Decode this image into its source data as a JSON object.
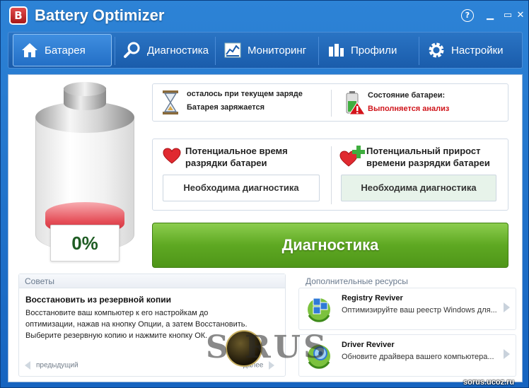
{
  "window": {
    "title": "Battery Optimizer",
    "logo_letter": "B",
    "help_label": "?",
    "minimize_label": "▁",
    "maximize_label": "▭",
    "close_label": "✕"
  },
  "nav": {
    "tabs": [
      {
        "label": "Батарея",
        "icon": "home-icon",
        "active": true
      },
      {
        "label": "Диагностика",
        "icon": "magnifier-icon",
        "active": false
      },
      {
        "label": "Мониторинг",
        "icon": "chart-icon",
        "active": false
      },
      {
        "label": "Профили",
        "icon": "plug-icon",
        "active": false
      },
      {
        "label": "Настройки",
        "icon": "gear-icon",
        "active": false
      }
    ]
  },
  "battery": {
    "percent_label": "0%",
    "charge_level": 0
  },
  "status": {
    "remaining_label": "осталось при текущем заряде",
    "charging_label": "Батарея заряжается",
    "state_label": "Состояние батареи:",
    "state_value": "Выполняется анализ"
  },
  "potential": {
    "discharge_title_1": "Потенциальное время",
    "discharge_title_2": "разрядки батареи",
    "discharge_value": "Необходима диагностика",
    "gain_title_1": "Потенциальный прирост",
    "gain_title_2": "времени разрядки батареи",
    "gain_value": "Необходима диагностика"
  },
  "diagnostics_button": "Диагностика",
  "tips": {
    "header": "Советы",
    "title": "Восстановить из резервной копии",
    "lines": [
      "Восстановите ваш компьютер к его настройкам до",
      "оптимизации, нажав на кнопку Опции, а затем Восстановить.",
      "Выберите резервную копию и нажмите кнопку ОК."
    ],
    "prev_label": "предыдущий",
    "next_label": "далее"
  },
  "resources": {
    "header": "Дополнительные ресурсы",
    "items": [
      {
        "title": "Registry Reviver",
        "desc": "Оптимизируйте ваш реестр Windows для..."
      },
      {
        "title": "Driver Reviver",
        "desc": "Обновите драйвера вашего компьютера..."
      }
    ]
  },
  "watermark": {
    "logo_text": "S  RUS",
    "url": "sorus.ucoz.ru"
  },
  "colors": {
    "accent_blue": "#1f6cc4",
    "diag_green": "#5ea822",
    "warn_red": "#d0161c",
    "percent_green": "#1f5d24"
  }
}
